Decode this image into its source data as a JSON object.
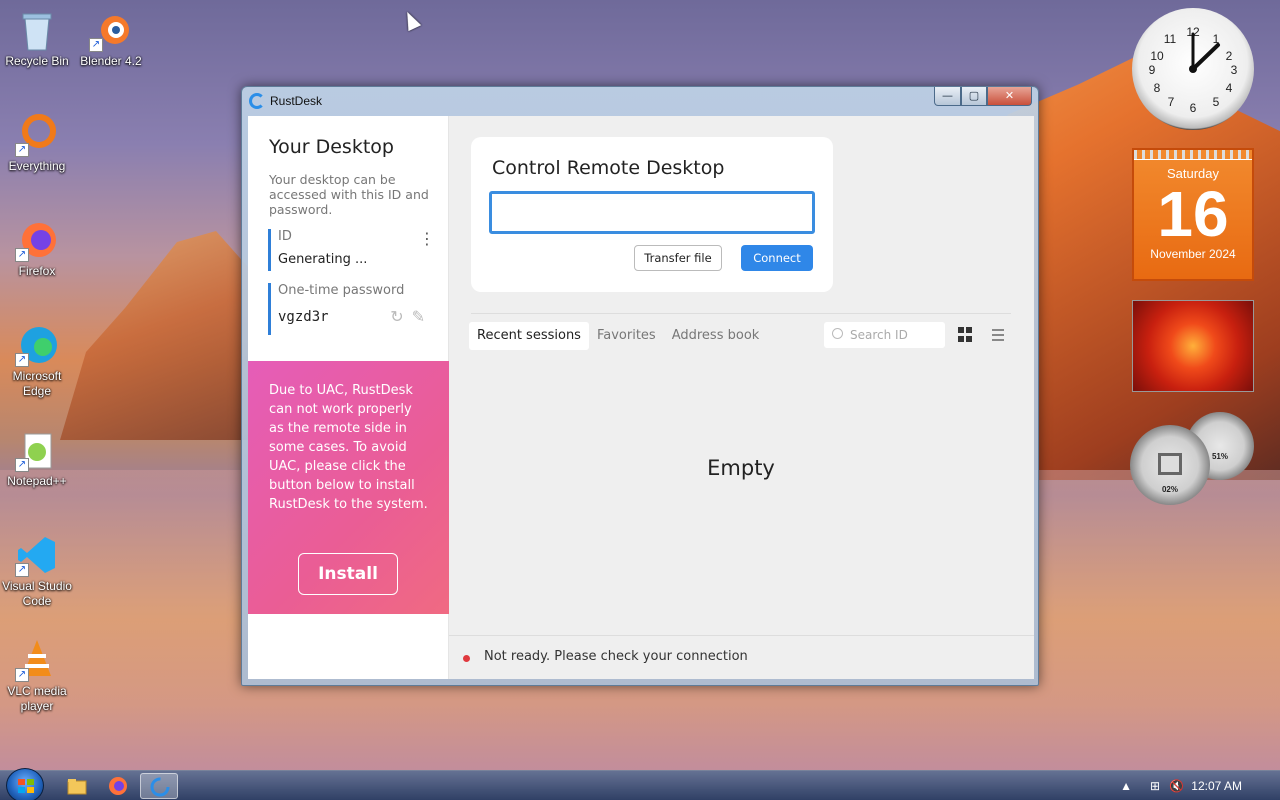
{
  "desktop": {
    "icons": [
      {
        "label": "Recycle Bin"
      },
      {
        "label": "Blender 4.2"
      },
      {
        "label": "Everything"
      },
      {
        "label": "Firefox"
      },
      {
        "label": "Microsoft Edge"
      },
      {
        "label": "Notepad++"
      },
      {
        "label": "Visual Studio Code"
      },
      {
        "label": "VLC media player"
      }
    ]
  },
  "gadgets": {
    "calendar": {
      "weekday": "Saturday",
      "day": "16",
      "month_year": "November 2024"
    },
    "cpu_meter": {
      "cpu": "02%",
      "memory": "51%"
    }
  },
  "window": {
    "title": "RustDesk",
    "caption": {
      "minimize": "—",
      "maximize": "▢",
      "close": "✕"
    },
    "left": {
      "heading": "Your Desktop",
      "description": "Your desktop can be accessed with this ID and password.",
      "id_label": "ID",
      "id_value": "Generating ...",
      "pw_label": "One-time password",
      "pw_value": "vgzd3r",
      "uac_message": "Due to UAC, RustDesk can not work properly as the remote side in some cases. To avoid UAC, please click the button below to install RustDesk to the system.",
      "install_label": "Install"
    },
    "remote": {
      "heading": "Control Remote Desktop",
      "input_value": "",
      "transfer_label": "Transfer file",
      "connect_label": "Connect"
    },
    "tabs": [
      "Recent sessions",
      "Favorites",
      "Address book"
    ],
    "search_placeholder": "Search ID",
    "empty_text": "Empty",
    "status_text": "Not ready. Please check your connection"
  },
  "taskbar": {
    "time": "12:07 AM"
  },
  "colors": {
    "accent": "#2f87e8",
    "uac": "#e85ca8",
    "status_dot": "#e0393e"
  }
}
